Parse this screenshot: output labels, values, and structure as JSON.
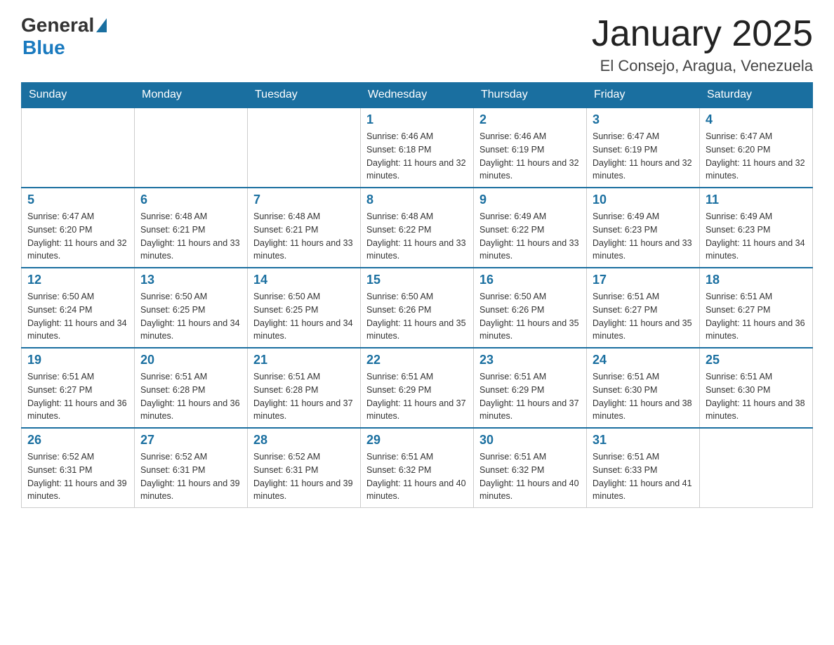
{
  "logo": {
    "general": "General",
    "blue": "Blue"
  },
  "header": {
    "title": "January 2025",
    "subtitle": "El Consejo, Aragua, Venezuela"
  },
  "days": [
    "Sunday",
    "Monday",
    "Tuesday",
    "Wednesday",
    "Thursday",
    "Friday",
    "Saturday"
  ],
  "weeks": [
    [
      {
        "day": "",
        "info": ""
      },
      {
        "day": "",
        "info": ""
      },
      {
        "day": "",
        "info": ""
      },
      {
        "day": "1",
        "info": "Sunrise: 6:46 AM\nSunset: 6:18 PM\nDaylight: 11 hours and 32 minutes."
      },
      {
        "day": "2",
        "info": "Sunrise: 6:46 AM\nSunset: 6:19 PM\nDaylight: 11 hours and 32 minutes."
      },
      {
        "day": "3",
        "info": "Sunrise: 6:47 AM\nSunset: 6:19 PM\nDaylight: 11 hours and 32 minutes."
      },
      {
        "day": "4",
        "info": "Sunrise: 6:47 AM\nSunset: 6:20 PM\nDaylight: 11 hours and 32 minutes."
      }
    ],
    [
      {
        "day": "5",
        "info": "Sunrise: 6:47 AM\nSunset: 6:20 PM\nDaylight: 11 hours and 32 minutes."
      },
      {
        "day": "6",
        "info": "Sunrise: 6:48 AM\nSunset: 6:21 PM\nDaylight: 11 hours and 33 minutes."
      },
      {
        "day": "7",
        "info": "Sunrise: 6:48 AM\nSunset: 6:21 PM\nDaylight: 11 hours and 33 minutes."
      },
      {
        "day": "8",
        "info": "Sunrise: 6:48 AM\nSunset: 6:22 PM\nDaylight: 11 hours and 33 minutes."
      },
      {
        "day": "9",
        "info": "Sunrise: 6:49 AM\nSunset: 6:22 PM\nDaylight: 11 hours and 33 minutes."
      },
      {
        "day": "10",
        "info": "Sunrise: 6:49 AM\nSunset: 6:23 PM\nDaylight: 11 hours and 33 minutes."
      },
      {
        "day": "11",
        "info": "Sunrise: 6:49 AM\nSunset: 6:23 PM\nDaylight: 11 hours and 34 minutes."
      }
    ],
    [
      {
        "day": "12",
        "info": "Sunrise: 6:50 AM\nSunset: 6:24 PM\nDaylight: 11 hours and 34 minutes."
      },
      {
        "day": "13",
        "info": "Sunrise: 6:50 AM\nSunset: 6:25 PM\nDaylight: 11 hours and 34 minutes."
      },
      {
        "day": "14",
        "info": "Sunrise: 6:50 AM\nSunset: 6:25 PM\nDaylight: 11 hours and 34 minutes."
      },
      {
        "day": "15",
        "info": "Sunrise: 6:50 AM\nSunset: 6:26 PM\nDaylight: 11 hours and 35 minutes."
      },
      {
        "day": "16",
        "info": "Sunrise: 6:50 AM\nSunset: 6:26 PM\nDaylight: 11 hours and 35 minutes."
      },
      {
        "day": "17",
        "info": "Sunrise: 6:51 AM\nSunset: 6:27 PM\nDaylight: 11 hours and 35 minutes."
      },
      {
        "day": "18",
        "info": "Sunrise: 6:51 AM\nSunset: 6:27 PM\nDaylight: 11 hours and 36 minutes."
      }
    ],
    [
      {
        "day": "19",
        "info": "Sunrise: 6:51 AM\nSunset: 6:27 PM\nDaylight: 11 hours and 36 minutes."
      },
      {
        "day": "20",
        "info": "Sunrise: 6:51 AM\nSunset: 6:28 PM\nDaylight: 11 hours and 36 minutes."
      },
      {
        "day": "21",
        "info": "Sunrise: 6:51 AM\nSunset: 6:28 PM\nDaylight: 11 hours and 37 minutes."
      },
      {
        "day": "22",
        "info": "Sunrise: 6:51 AM\nSunset: 6:29 PM\nDaylight: 11 hours and 37 minutes."
      },
      {
        "day": "23",
        "info": "Sunrise: 6:51 AM\nSunset: 6:29 PM\nDaylight: 11 hours and 37 minutes."
      },
      {
        "day": "24",
        "info": "Sunrise: 6:51 AM\nSunset: 6:30 PM\nDaylight: 11 hours and 38 minutes."
      },
      {
        "day": "25",
        "info": "Sunrise: 6:51 AM\nSunset: 6:30 PM\nDaylight: 11 hours and 38 minutes."
      }
    ],
    [
      {
        "day": "26",
        "info": "Sunrise: 6:52 AM\nSunset: 6:31 PM\nDaylight: 11 hours and 39 minutes."
      },
      {
        "day": "27",
        "info": "Sunrise: 6:52 AM\nSunset: 6:31 PM\nDaylight: 11 hours and 39 minutes."
      },
      {
        "day": "28",
        "info": "Sunrise: 6:52 AM\nSunset: 6:31 PM\nDaylight: 11 hours and 39 minutes."
      },
      {
        "day": "29",
        "info": "Sunrise: 6:51 AM\nSunset: 6:32 PM\nDaylight: 11 hours and 40 minutes."
      },
      {
        "day": "30",
        "info": "Sunrise: 6:51 AM\nSunset: 6:32 PM\nDaylight: 11 hours and 40 minutes."
      },
      {
        "day": "31",
        "info": "Sunrise: 6:51 AM\nSunset: 6:33 PM\nDaylight: 11 hours and 41 minutes."
      },
      {
        "day": "",
        "info": ""
      }
    ]
  ]
}
